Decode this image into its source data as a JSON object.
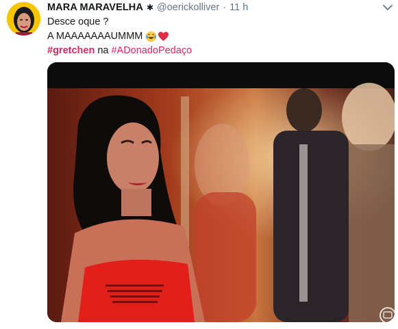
{
  "tweet": {
    "display_name": "MARA MARAVELHA",
    "badge_icon": "asterisk-badge-icon",
    "handle": "@oerickolliver",
    "separator": "·",
    "time": "11 h",
    "menu_icon": "chevron-down-icon",
    "line1": "Desce oque ?",
    "line2": "A MAAAAAAAUMMM",
    "line2_emojis": [
      "face-with-tears-of-joy-icon",
      "red-heart-icon"
    ],
    "hashtag_primary": "#gretchen",
    "connector": "na",
    "hashtag_secondary": "#ADonadoPedaço"
  },
  "colors": {
    "hashtag": "#e0245e",
    "name": "#14171a",
    "meta": "#657786",
    "avatar_background": "#f6c400"
  },
  "media": {
    "type": "photo",
    "watermark_icon": "tv-globo-logo-icon"
  }
}
